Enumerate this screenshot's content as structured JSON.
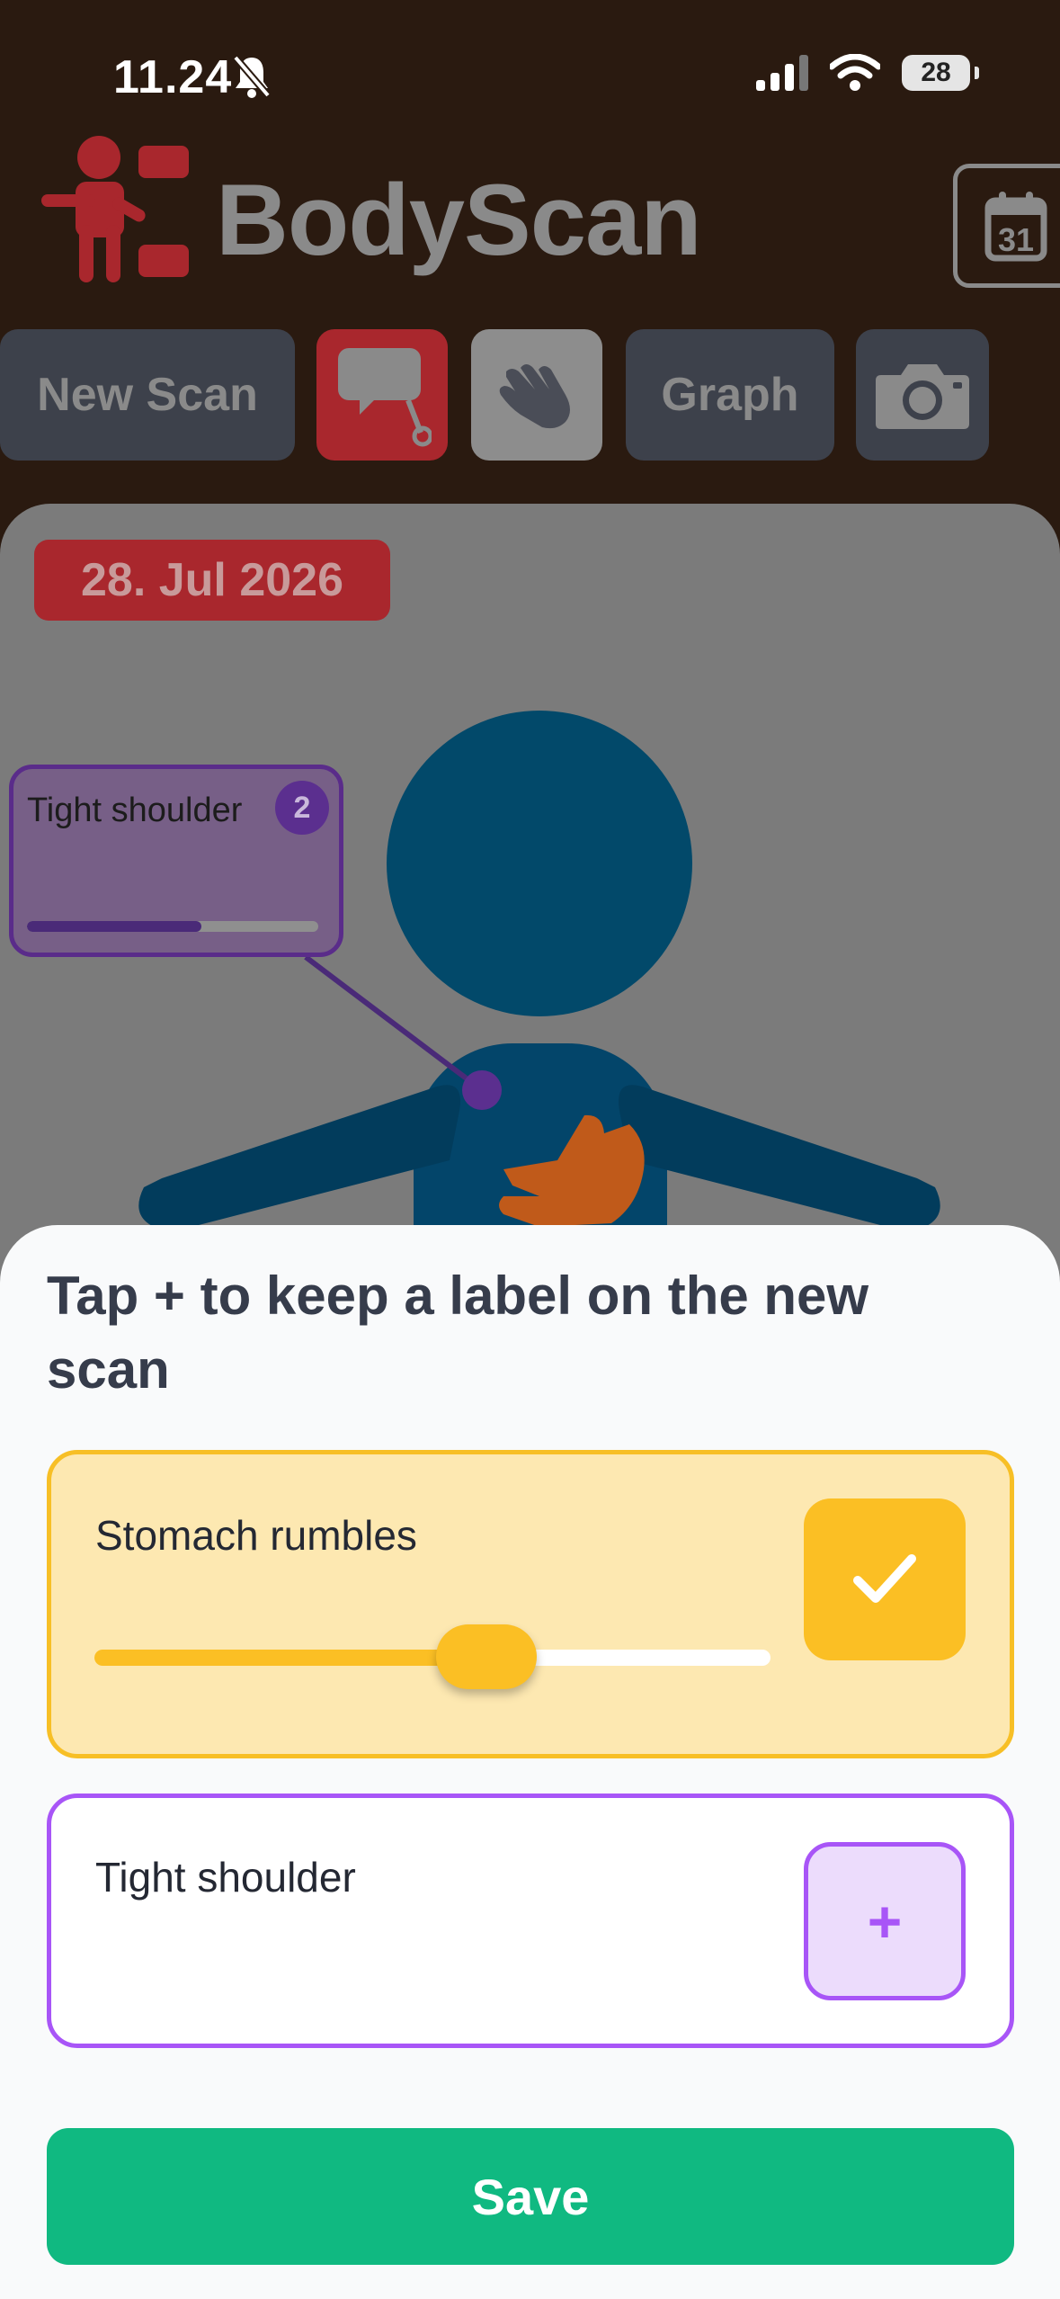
{
  "status_bar": {
    "time": "11.24",
    "battery": "28"
  },
  "header": {
    "title": "BodyScan",
    "calendar_day": "31"
  },
  "toolbar": {
    "new_scan": "New Scan",
    "graph": "Graph"
  },
  "scan": {
    "date": "28. Jul 2026",
    "label_bubble": {
      "text": "Tight shoulder",
      "count": "2",
      "intensity": 0.6
    }
  },
  "sheet": {
    "title": "Tap + to keep a label on the new scan",
    "labels": [
      {
        "name": "Stomach rumbles",
        "kept": true,
        "intensity": 0.58,
        "color": "#fbbf24"
      },
      {
        "name": "Tight shoulder",
        "kept": false,
        "color": "#a855f7",
        "action": "+"
      }
    ],
    "save": "Save"
  },
  "colors": {
    "accent_red": "#a9272d",
    "save_green": "#10b981",
    "amber": "#fbbf24",
    "purple": "#a855f7"
  }
}
